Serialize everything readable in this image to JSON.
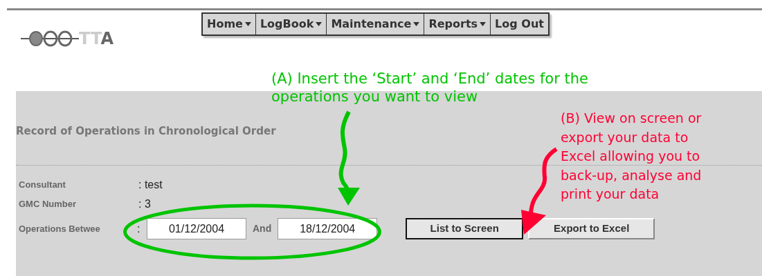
{
  "logo": {
    "light": "TT",
    "dark": "A"
  },
  "menu": [
    {
      "label": "Home",
      "dropdown": true
    },
    {
      "label": "LogBook",
      "dropdown": true
    },
    {
      "label": "Maintenance",
      "dropdown": true
    },
    {
      "label": "Reports",
      "dropdown": true
    },
    {
      "label": "Log Out",
      "dropdown": false
    }
  ],
  "panel": {
    "title": "Record of Operations in Chronological Order",
    "fields": [
      {
        "label": "Consultant",
        "value": ": test"
      },
      {
        "label": "GMC Number",
        "value": ": 3"
      }
    ],
    "range": {
      "label": "Operations Betwee",
      "separator": ":",
      "start": "01/12/2004",
      "and": "And",
      "end": "18/12/2004"
    },
    "buttons": [
      {
        "label": "List to Screen",
        "focused": true
      },
      {
        "label": "Export to Excel",
        "focused": false
      }
    ]
  },
  "annotations": [
    {
      "kind": "green",
      "lines": [
        "(A) Insert the ‘Start’ and ‘End’ dates for the",
        "operations you want to view"
      ]
    },
    {
      "kind": "red",
      "lines": [
        "(B) View on screen or",
        "export your data to",
        "Excel allowing you to",
        "back-up, analyse and",
        "print your data"
      ]
    }
  ]
}
